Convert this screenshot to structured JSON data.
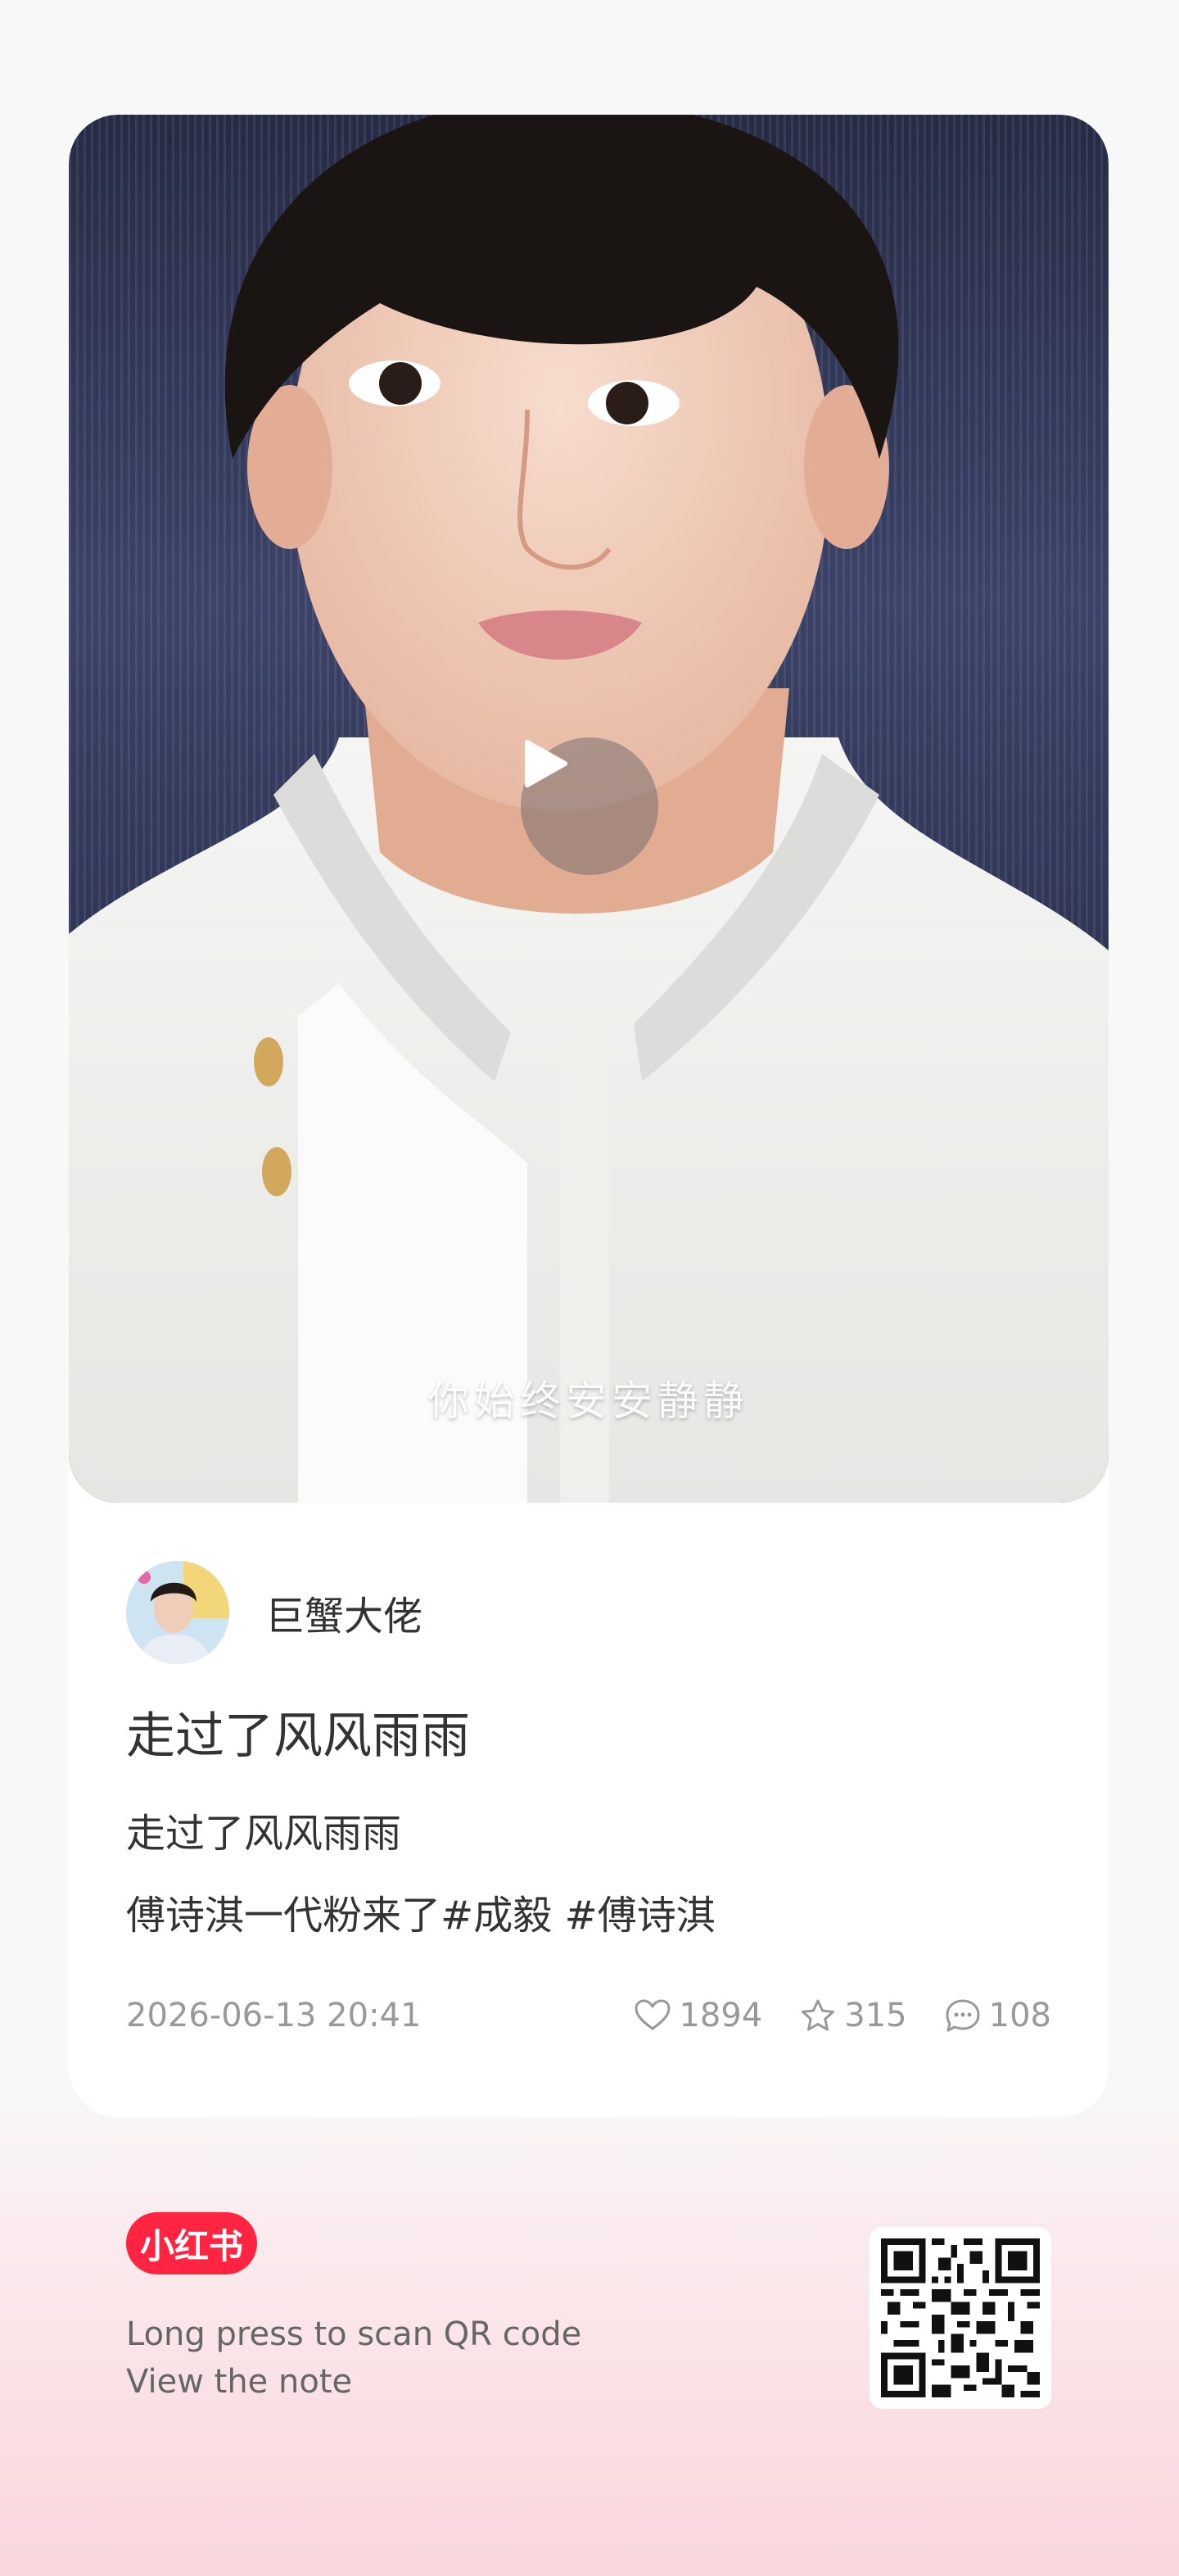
{
  "cover": {
    "subtitle": "你始终安安静静"
  },
  "author": {
    "name": "巨蟹大佬"
  },
  "note": {
    "title": "走过了风风雨雨",
    "desc_line1": "走过了风风雨雨",
    "desc_line2_text": "傅诗淇一代粉来了",
    "tags": [
      "#成毅",
      "#傅诗淇"
    ]
  },
  "meta": {
    "date": "2026-06-13 20:41",
    "likes": "1894",
    "collects": "315",
    "comments": "108"
  },
  "footer": {
    "logo": "小红书",
    "line1": "Long press to scan QR code",
    "line2": "View the note"
  },
  "colors": {
    "brand": "#ff2442",
    "muted": "#999999",
    "text": "#333333"
  }
}
